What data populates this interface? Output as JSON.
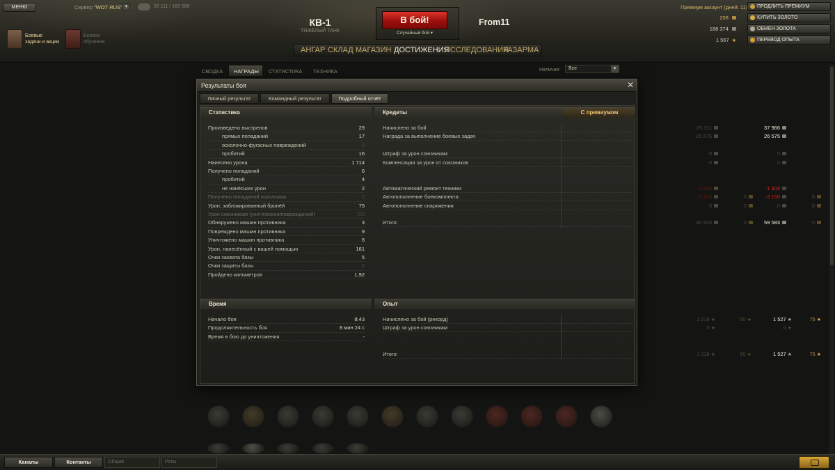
{
  "topbar": {
    "menu_label": "МЕНЮ",
    "server_prefix": "Сервер ",
    "server_name": "\"WOT RUS\"",
    "online_count": "20 111 / 165 680",
    "quests_label_1": "Боевые",
    "quests_label_2": "задачи и акции",
    "training_label_1": "Боевое",
    "training_label_2": "обучение",
    "tank_name": "КВ-1",
    "tank_type": "ТЯЖЁЛЫЙ ТАНК",
    "battle_label": "В бой!",
    "battle_mode": "Случайный бой",
    "player_name": "From11",
    "nav": [
      "АНГАР",
      "СКЛАД",
      "МАГАЗИН",
      "ДОСТИЖЕНИЯ",
      "ИССЛЕДОВАНИЯ",
      "КАЗАРМА"
    ],
    "nav_active": "ДОСТИЖЕНИЯ",
    "premium_label": "Премиум аккаунт (дней:  11)",
    "gold": "208",
    "credits": "188 374",
    "free_xp": "1 567",
    "btn_extend_premium": "ПРОДЛИТЬ ПРЕМИУМ",
    "btn_buy_gold": "КУПИТЬ ЗОЛОТО",
    "btn_exchange_gold": "ОБМЕН ЗОЛОТА",
    "btn_convert_xp": "ПЕРЕВОД ОПЫТА"
  },
  "page": {
    "tabs": [
      "СВОДКА",
      "НАГРАДЫ",
      "СТАТИСТИКА",
      "ТЕХНИКА"
    ],
    "active_tab": "НАГРАДЫ",
    "availability_label": "Наличие:",
    "availability_value": "Все"
  },
  "dialog": {
    "title": "Результаты боя",
    "tabs": [
      "Личный результат",
      "Командный результат",
      "Подробный отчёт"
    ],
    "active_tab": "Подробный отчёт",
    "stats": {
      "header": "Статистика",
      "rows": [
        {
          "label": "Произведено выстрелов",
          "value": "29"
        },
        {
          "label": "прямых попаданий",
          "value": "17"
        },
        {
          "label": "осколочно-фугасных повреждений",
          "value": "0"
        },
        {
          "label": "пробитий",
          "value": "16"
        },
        {
          "label": "Нанесено урона",
          "value": "1 714"
        },
        {
          "label": "Получено попаданий",
          "value": "6"
        },
        {
          "label": "пробитий",
          "value": "4"
        },
        {
          "label": "не нанёсших урон",
          "value": "2"
        },
        {
          "label": "Получено попаданий осколками",
          "value": "0"
        },
        {
          "label": "Урон, заблокированный бронёй",
          "value": "75"
        },
        {
          "label": "Урон союзникам (уничтожено/повреждений)",
          "value": "0/0"
        },
        {
          "label": "Обнаружено машин противника",
          "value": "3"
        },
        {
          "label": "Повреждено машин противника",
          "value": "9"
        },
        {
          "label": "Уничтожено машин противника",
          "value": "6"
        },
        {
          "label": "Урон, нанесённый с вашей помощью",
          "value": "161"
        },
        {
          "label": "Очки захвата базы",
          "value": "5"
        },
        {
          "label": "Очки защиты базы",
          "value": "0"
        },
        {
          "label": "Пройдено километров",
          "value": "1,92"
        }
      ]
    },
    "credits": {
      "header": "Кредиты",
      "premium_header": "С премиумом",
      "rows": [
        {
          "label": "Начислено за бой",
          "base": "25 311",
          "base_gold": "",
          "prem": "37 966",
          "prem_gold": ""
        },
        {
          "label": "Награда за выполнение боевых задач",
          "base": "26 575",
          "base_gold": "",
          "prem": "26 575",
          "prem_gold": ""
        },
        {
          "label": "",
          "base": "",
          "base_gold": "",
          "prem": "",
          "prem_gold": ""
        },
        {
          "label": "Штраф за урон союзникам",
          "base": "0",
          "base_gold": "",
          "prem": "0",
          "prem_gold": ""
        },
        {
          "label": "Компенсация за урон от союзников",
          "base": "0",
          "base_gold": "",
          "prem": "0",
          "prem_gold": ""
        },
        {
          "label": "",
          "base": "",
          "base_gold": "",
          "prem": "",
          "prem_gold": ""
        },
        {
          "label": "",
          "base": "",
          "base_gold": "",
          "prem": "",
          "prem_gold": ""
        },
        {
          "label": "Автоматический ремонт техники",
          "base": "-1 808",
          "base_gold": "",
          "prem": "-1 808",
          "prem_gold": ""
        },
        {
          "label": "Автопополнение боекомплекта",
          "base": "-3 150",
          "base_gold": "0",
          "prem": "-3 150",
          "prem_gold": "0"
        },
        {
          "label": "Автопополнение снаряжения",
          "base": "0",
          "base_gold": "0",
          "prem": "0",
          "prem_gold": "0"
        },
        {
          "label": "",
          "base": "",
          "base_gold": "",
          "prem": "",
          "prem_gold": ""
        },
        {
          "label": "Итого:",
          "base": "46 928",
          "base_gold": "0",
          "prem": "59 583",
          "prem_gold": "0"
        }
      ]
    },
    "time": {
      "header": "Время",
      "rows": [
        {
          "label": "Начало боя",
          "value": "8:43"
        },
        {
          "label": "Продолжительность боя",
          "value": "8 мин 24 с"
        },
        {
          "label": "Время в бою до уничтожения",
          "value": "-"
        }
      ]
    },
    "xp": {
      "header": "Опыт",
      "rows": [
        {
          "label": "Начислено за бой (рекорд)",
          "base": "1 018",
          "base_free": "50",
          "prem": "1 527",
          "prem_free": "75"
        },
        {
          "label": "Штраф за урон союзникам",
          "base": "0",
          "base_free": "",
          "prem": "0",
          "prem_free": ""
        },
        {
          "label": "",
          "base": "",
          "base_free": "",
          "prem": "",
          "prem_free": ""
        },
        {
          "label": "",
          "base": "",
          "base_free": "",
          "prem": "",
          "prem_free": ""
        },
        {
          "label": "Итого:",
          "base": "1 018",
          "base_free": "50",
          "prem": "1 527",
          "prem_free": "75"
        }
      ]
    }
  },
  "bottombar": {
    "channels": "Каналы",
    "contacts": "Контакты",
    "input_general": "Общий",
    "input_squads": "Роты"
  }
}
